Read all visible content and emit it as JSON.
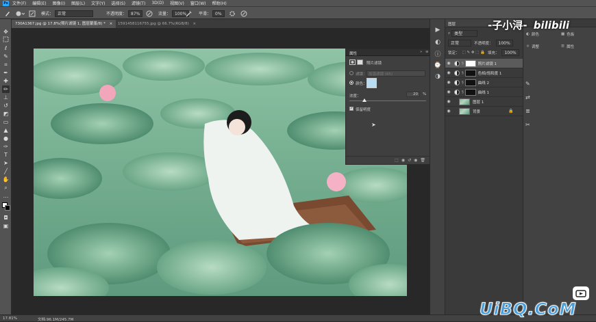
{
  "menubar": {
    "app_icon": "Ps",
    "items": [
      "文件(F)",
      "编辑(E)",
      "图像(I)",
      "图层(L)",
      "文字(Y)",
      "选择(S)",
      "滤镜(T)",
      "3D(D)",
      "视图(V)",
      "窗口(W)",
      "帮助(H)"
    ]
  },
  "options": {
    "mode_label": "模式：",
    "mode_value": "正常",
    "opacity_label": "不透明度：",
    "opacity_value": "87%",
    "flow_label": "流量：",
    "flow_value": "100%",
    "smooth_label": "平滑：",
    "smooth_value": "0%"
  },
  "tabs": [
    {
      "label": "730A1367.jpg @ 17.8%(照片滤镜 1, 图层蒙版/8) *",
      "close": "×"
    },
    {
      "label": "1591458116755.jpg @ 66.7%(RGB/8)",
      "close": "×"
    }
  ],
  "properties": {
    "panel_title": "属性",
    "subtitle": "照片滤镜",
    "filter_label": "滤镜：",
    "filter_value": "加温滤镜 (85)",
    "color_label": "颜色：",
    "color_swatch": "#b9dcf0",
    "density_label": "浓度：",
    "density_value": "20",
    "density_unit": "%",
    "density_fraction": 0.2,
    "preserve_label": "保留明度"
  },
  "layers": {
    "panel_title": "图层",
    "kind_label": "类型",
    "blend_mode": "正常",
    "opacity_label": "不透明度：",
    "opacity_value": "100%",
    "lock_label": "锁定：",
    "fill_label": "填充：",
    "fill_value": "100%",
    "items": [
      {
        "name": "照片滤镜 1",
        "type": "adjustment",
        "selected": true
      },
      {
        "name": "色相/饱和度 1",
        "type": "adjustment",
        "selected": false
      },
      {
        "name": "曲线 2",
        "type": "adjustment",
        "selected": false
      },
      {
        "name": "曲线 1",
        "type": "adjustment",
        "selected": false
      },
      {
        "name": "图层 1",
        "type": "pixel",
        "selected": false
      },
      {
        "name": "背景",
        "type": "pixel",
        "selected": false
      }
    ]
  },
  "rightpanel": {
    "tabs": [
      "颜色",
      "色板"
    ],
    "items": [
      "调整",
      "属性"
    ]
  },
  "status": {
    "zoom": "17.81%",
    "doc": "文档:96.1M/245.7M"
  },
  "watermark": "-子小浔-",
  "bilibili": "bilibili",
  "uibq": "UiBQ.CoM",
  "colors": {
    "accent": "#31a8ff",
    "ui_dark": "#282828",
    "ui_mid": "#535353",
    "photo_tint": "#7fb79a"
  }
}
